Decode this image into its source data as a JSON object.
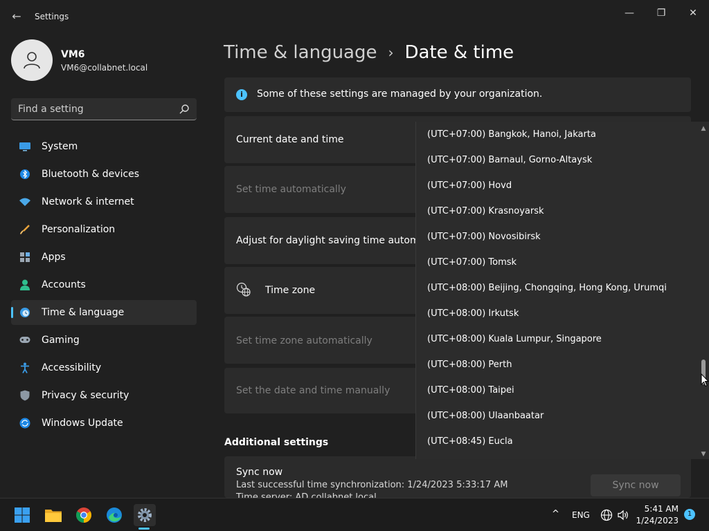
{
  "window": {
    "title": "Settings",
    "back_glyph": "←",
    "minimize_glyph": "—",
    "maximize_glyph": "❐",
    "close_glyph": "✕"
  },
  "user": {
    "name": "VM6",
    "email": "VM6@collabnet.local"
  },
  "search": {
    "placeholder": "Find a setting",
    "icon": "search-icon"
  },
  "nav": {
    "items": [
      {
        "label": "System",
        "icon": "monitor-icon"
      },
      {
        "label": "Bluetooth & devices",
        "icon": "bluetooth-icon"
      },
      {
        "label": "Network & internet",
        "icon": "wifi-icon"
      },
      {
        "label": "Personalization",
        "icon": "brush-icon"
      },
      {
        "label": "Apps",
        "icon": "apps-icon"
      },
      {
        "label": "Accounts",
        "icon": "person-icon"
      },
      {
        "label": "Time & language",
        "icon": "clock-globe-icon",
        "active": true
      },
      {
        "label": "Gaming",
        "icon": "gamepad-icon"
      },
      {
        "label": "Accessibility",
        "icon": "accessibility-icon"
      },
      {
        "label": "Privacy & security",
        "icon": "shield-icon"
      },
      {
        "label": "Windows Update",
        "icon": "update-icon"
      }
    ]
  },
  "breadcrumb": {
    "parent": "Time & language",
    "separator": "›",
    "current": "Date & time"
  },
  "info_bar": {
    "icon_glyph": "i",
    "text": "Some of these settings are managed by your organization."
  },
  "cards": {
    "current_date_time": "Current date and time",
    "set_time_auto": "Set time automatically",
    "daylight_saving": "Adjust for daylight saving time automatica",
    "time_zone": "Time zone",
    "set_tz_auto": "Set time zone automatically",
    "set_manually": "Set the date and time manually"
  },
  "additional": {
    "title": "Additional settings",
    "sync_title": "Sync now",
    "last_sync": "Last successful time synchronization: 1/24/2023 5:33:17 AM",
    "time_server": "Time server: AD.collabnet.local",
    "sync_button": "Sync now"
  },
  "timezone_dropdown": {
    "options": [
      "(UTC+07:00) Bangkok, Hanoi, Jakarta",
      "(UTC+07:00) Barnaul, Gorno-Altaysk",
      "(UTC+07:00) Hovd",
      "(UTC+07:00) Krasnoyarsk",
      "(UTC+07:00) Novosibirsk",
      "(UTC+07:00) Tomsk",
      "(UTC+08:00) Beijing, Chongqing, Hong Kong, Urumqi",
      "(UTC+08:00) Irkutsk",
      "(UTC+08:00) Kuala Lumpur, Singapore",
      "(UTC+08:00) Perth",
      "(UTC+08:00) Taipei",
      "(UTC+08:00) Ulaanbaatar",
      "(UTC+08:45) Eucla"
    ],
    "scroll_up_glyph": "▲",
    "scroll_down_glyph": "▼"
  },
  "taskbar": {
    "apps": [
      "start-icon",
      "file-explorer-icon",
      "chrome-icon",
      "edge-icon",
      "settings-icon"
    ],
    "tray_chevron": "^",
    "language": "ENG",
    "time": "5:41 AM",
    "date": "1/24/2023",
    "notification_count": "1"
  },
  "colors": {
    "accent": "#4cc2ff",
    "background": "#202020",
    "card": "#2b2b2b",
    "dropdown": "#2c2c2c",
    "taskbar": "#1c1c1c"
  }
}
